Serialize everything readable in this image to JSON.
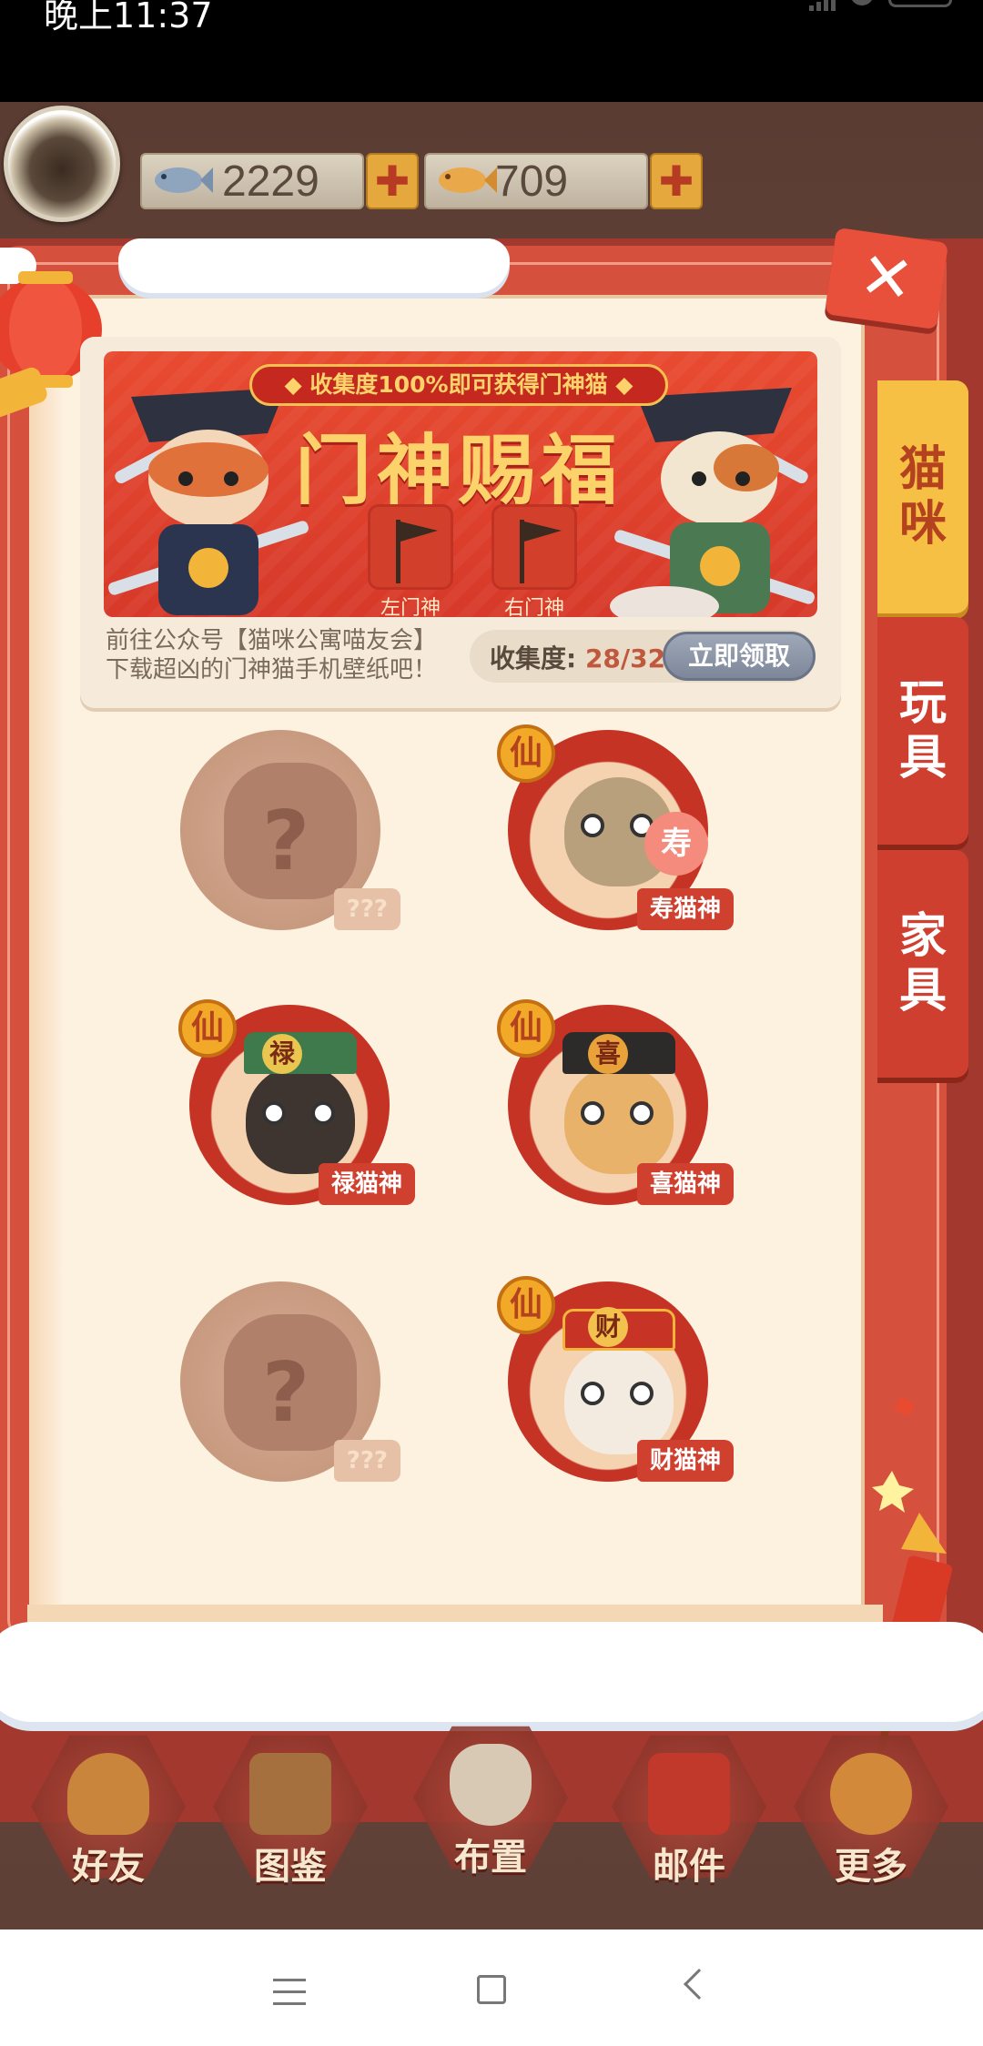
{
  "status": {
    "time": "晚上11:37"
  },
  "currency": {
    "fish_blue": "2229",
    "fish_gold": "709",
    "add_symbol": "✚"
  },
  "close_symbol": "✕",
  "tabs": [
    {
      "label_1": "猫",
      "label_2": "咪"
    },
    {
      "label_1": "玩",
      "label_2": "具"
    },
    {
      "label_1": "家",
      "label_2": "具"
    }
  ],
  "banner": {
    "pill_text": "◆ 收集度100%即可获得门神猫 ◆",
    "title": "门神赐福",
    "left_door": "左门神",
    "right_door": "右门神"
  },
  "info": {
    "line1": "前往公众号【猫咪公寓喵友会】",
    "line2": "下载超凶的门神猫手机壁纸吧！",
    "progress_label": "收集度:",
    "progress_value": "28/32",
    "claim_button": "立即领取"
  },
  "cats": [
    {
      "name": "???",
      "locked": true
    },
    {
      "name": "寿猫神",
      "locked": false,
      "badge": "仙",
      "hat_char": "寿"
    },
    {
      "name": "禄猫神",
      "locked": false,
      "badge": "仙",
      "hat_char": "禄"
    },
    {
      "name": "喜猫神",
      "locked": false,
      "badge": "仙",
      "hat_char": "喜"
    },
    {
      "name": "???",
      "locked": true
    },
    {
      "name": "财猫神",
      "locked": false,
      "badge": "仙",
      "hat_char": "财"
    }
  ],
  "locked_symbol": "?",
  "bottom_nav": [
    {
      "label": "好友",
      "icon": "friends-icon"
    },
    {
      "label": "图鉴",
      "icon": "album-icon"
    },
    {
      "label": "布置",
      "icon": "decorate-icon"
    },
    {
      "label": "邮件",
      "icon": "mail-icon"
    },
    {
      "label": "更多",
      "icon": "more-icon"
    }
  ],
  "colors": {
    "panel_red": "#d6503e",
    "tab_active": "#f6c045",
    "tab_inactive": "#cf3f30",
    "badge_gold": "#f2a927",
    "book_paper": "#fdf1e0"
  }
}
